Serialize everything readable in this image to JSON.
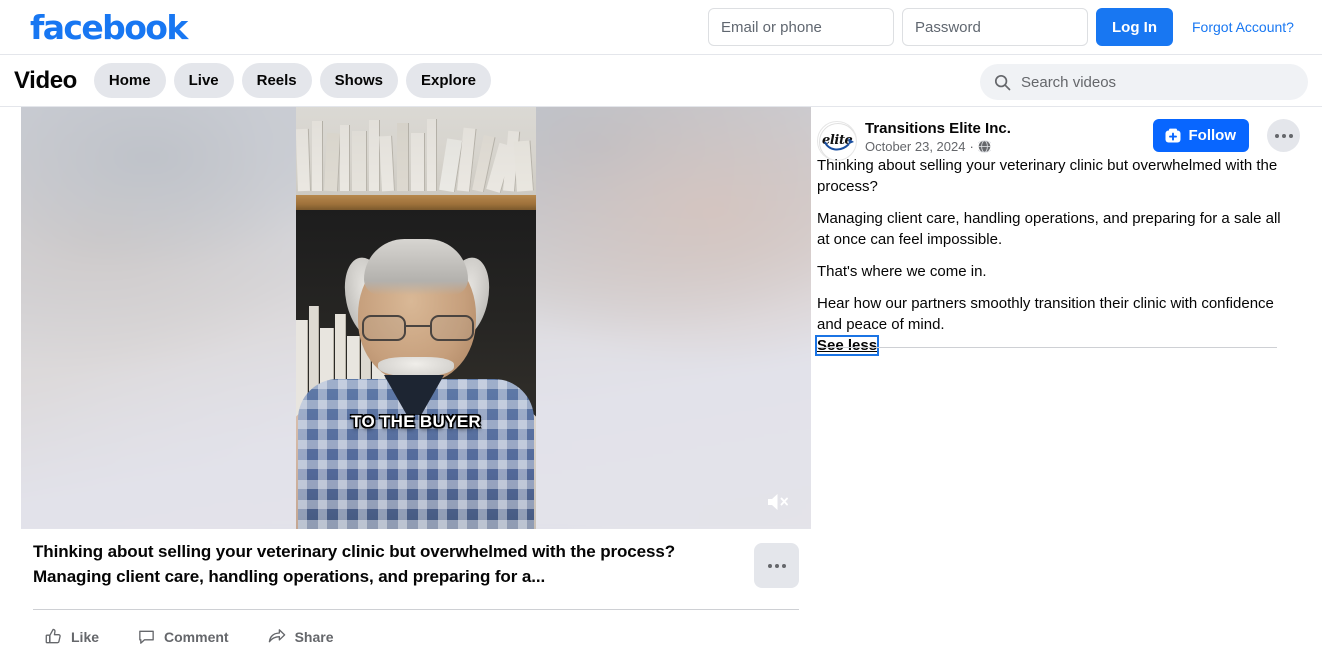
{
  "topbar": {
    "logo_text": "facebook",
    "email_placeholder": "Email or phone",
    "email_value": "",
    "password_placeholder": "Password",
    "password_value": "",
    "login_label": "Log In",
    "forgot_label": "Forgot Account?",
    "brand_color": "#1877f2"
  },
  "videonav": {
    "title": "Video",
    "pills": [
      {
        "label": "Home"
      },
      {
        "label": "Live"
      },
      {
        "label": "Reels"
      },
      {
        "label": "Shows"
      },
      {
        "label": "Explore"
      }
    ],
    "search_placeholder": "Search videos",
    "search_value": "",
    "search_icon": "search-icon"
  },
  "video": {
    "caption_overlay": "TO THE BUYER",
    "mute_icon": "speaker-muted-icon",
    "title": "Thinking about selling your veterinary clinic but overwhelmed with the process? Managing client care, handling operations, and preparing for a...",
    "menu_icon": "three-dots-icon",
    "actions": [
      {
        "label": "Like",
        "icon": "thumbs-up-icon"
      },
      {
        "label": "Comment",
        "icon": "comment-bubble-icon"
      },
      {
        "label": "Share",
        "icon": "share-arrow-icon"
      }
    ]
  },
  "post": {
    "avatar_text": "elite",
    "avatar_icon": "transitions-elite-logo",
    "page_name": "Transitions Elite Inc.",
    "date": "October 23, 2024",
    "meta_separator": "·",
    "privacy_icon": "globe-icon",
    "follow_label": "Follow",
    "follow_icon": "follow-plus-icon",
    "follow_color": "#0866ff",
    "menu_icon": "three-dots-icon",
    "paragraphs": [
      "Thinking about selling your veterinary clinic but overwhelmed with the process?",
      "Managing client care, handling operations, and preparing for a sale all at once can feel impossible.",
      "That's where we come in.",
      "Hear how our partners smoothly transition their clinic with confidence and peace of mind."
    ],
    "see_less_label": "See less",
    "focus_color": "#1b74e4"
  }
}
